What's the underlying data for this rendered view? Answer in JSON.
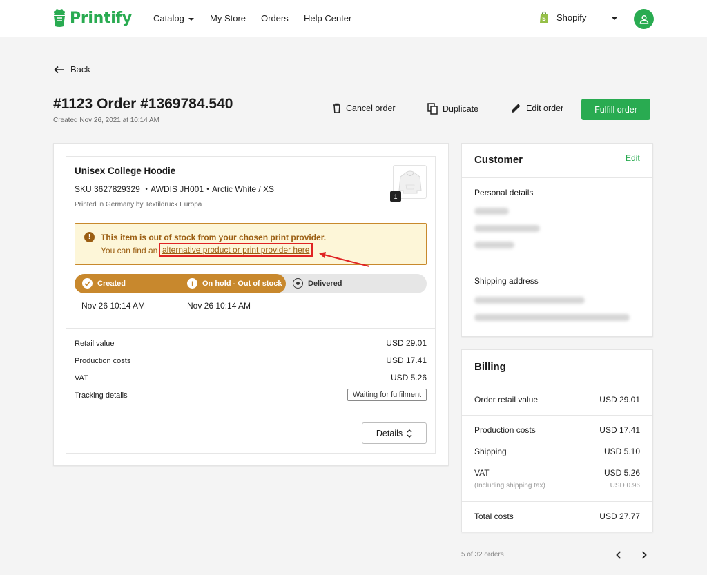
{
  "header": {
    "logo_text": "Printify",
    "nav": [
      "Catalog",
      "My Store",
      "Orders",
      "Help Center"
    ],
    "store_name": "Shopify"
  },
  "page": {
    "back_label": "Back",
    "order_title": "#1123 Order #1369784.540",
    "created": "Created Nov 26, 2021 at 10:14 AM",
    "actions": {
      "cancel": "Cancel order",
      "duplicate": "Duplicate",
      "edit": "Edit order",
      "fulfill": "Fulfill order"
    }
  },
  "item": {
    "name": "Unisex College Hoodie",
    "sku_line": "SKU 3627829329 ・AWDIS JH001・Arctic White / XS",
    "printed": "Printed in Germany by Textildruck Europa",
    "quantity": "1",
    "warning_title": "This item is out of stock from your chosen print provider.",
    "warning_text": "You can find an",
    "warning_link": "alternative product or print provider here",
    "steps": [
      "Created",
      "On hold - Out of stock",
      "Delivered"
    ],
    "step_dates": [
      "Nov 26 10:14 AM",
      "Nov 26 10:14 AM"
    ],
    "rows": [
      {
        "label": "Retail value",
        "value": "USD 29.01"
      },
      {
        "label": "Production costs",
        "value": "USD 17.41"
      },
      {
        "label": "VAT",
        "value": "USD 5.26"
      },
      {
        "label": "Tracking details",
        "value": ""
      }
    ],
    "tracking_badge": "Waiting for fulfilment",
    "details_label": "Details"
  },
  "customer": {
    "title": "Customer",
    "edit_label": "Edit",
    "personal_title": "Personal details",
    "shipping_title": "Shipping address"
  },
  "billing": {
    "title": "Billing",
    "order_retail_label": "Order retail value",
    "order_retail_value": "USD 29.01",
    "production_label": "Production costs",
    "production_value": "USD 17.41",
    "shipping_label": "Shipping",
    "shipping_value": "USD 5.10",
    "vat_label": "VAT",
    "vat_value": "USD 5.26",
    "vat_note": "(Including shipping tax)",
    "vat_note_value": "USD 0.96",
    "total_label": "Total costs",
    "total_value": "USD 27.77"
  },
  "pager": {
    "text": "5 of 32 orders"
  },
  "colors": {
    "brand_green": "#29ab51",
    "warning_brown": "#9b5e12",
    "progress_orange": "#c8882d",
    "annotation_red": "#e02424"
  }
}
